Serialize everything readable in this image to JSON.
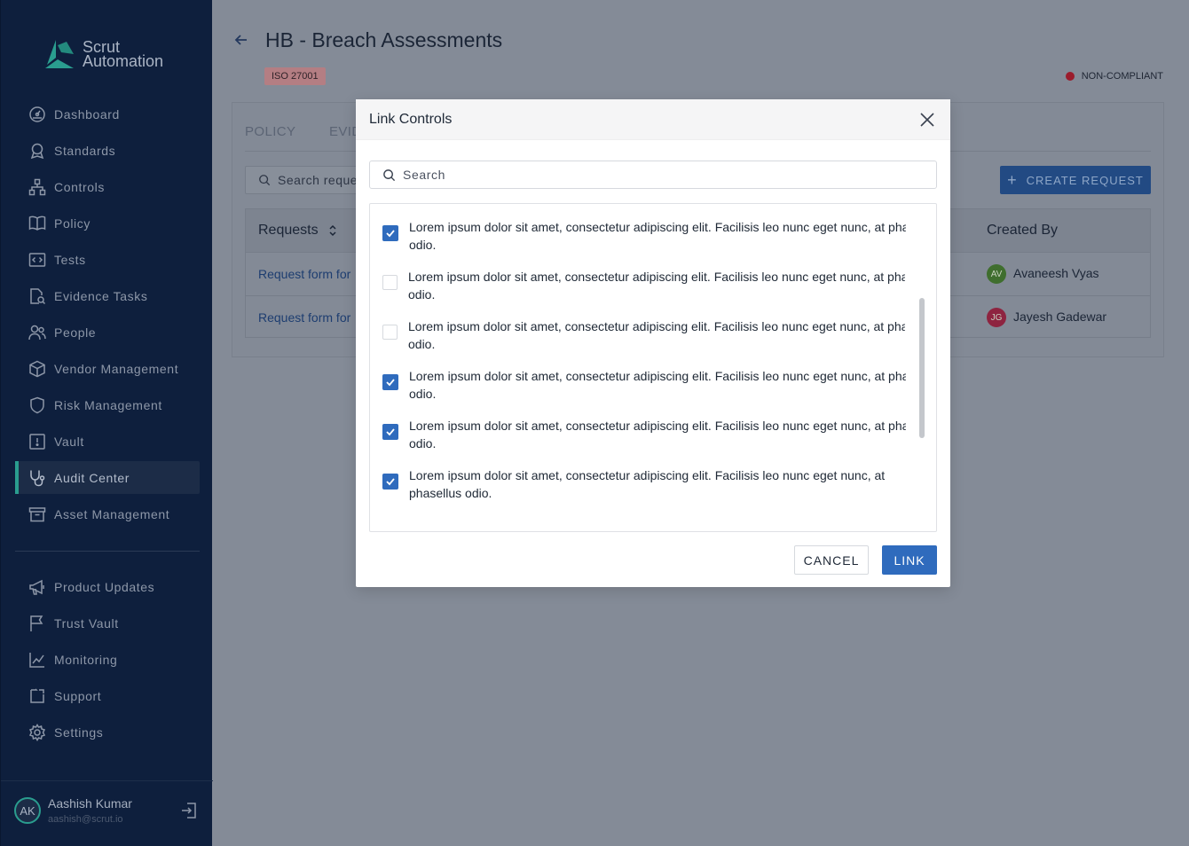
{
  "sidebar": {
    "logo_line1": "Scrut",
    "logo_line2": "Automation",
    "items": [
      {
        "label": "Dashboard",
        "icon": "dashboard-icon"
      },
      {
        "label": "Standards",
        "icon": "award-icon"
      },
      {
        "label": "Controls",
        "icon": "hierarchy-icon"
      },
      {
        "label": "Policy",
        "icon": "book-icon"
      },
      {
        "label": "Tests",
        "icon": "code-icon"
      },
      {
        "label": "Evidence Tasks",
        "icon": "file-search-icon"
      },
      {
        "label": "People",
        "icon": "people-icon"
      },
      {
        "label": "Vendor Management",
        "icon": "box-icon"
      },
      {
        "label": "Risk Management",
        "icon": "shield-icon"
      },
      {
        "label": "Vault",
        "icon": "vault-icon"
      },
      {
        "label": "Audit Center",
        "icon": "stethoscope-icon",
        "active": true
      },
      {
        "label": "Asset Management",
        "icon": "archive-icon"
      }
    ],
    "items2": [
      {
        "label": "Product Updates",
        "icon": "megaphone-icon"
      },
      {
        "label": "Trust Vault",
        "icon": "flag-icon"
      },
      {
        "label": "Monitoring",
        "icon": "chart-line-icon"
      },
      {
        "label": "Support",
        "icon": "support-icon"
      },
      {
        "label": "Settings",
        "icon": "gear-icon"
      }
    ],
    "user": {
      "initials": "AK",
      "name": "Aashish Kumar",
      "email": "aashish@scrut.io"
    }
  },
  "page": {
    "title": "HB - Breach Assessments",
    "badge": "ISO 27001",
    "status": "NON-COMPLIANT",
    "tabs": [
      "POLICY",
      "EVID"
    ],
    "search_placeholder": "Search reque",
    "create_button": "CREATE REQUEST",
    "table": {
      "col_requests": "Requests",
      "col_created_by": "Created By",
      "rows": [
        {
          "request": "Request form for",
          "initials": "AV",
          "creator": "Avaneesh Vyas",
          "avatar_color": "#3f6e2e"
        },
        {
          "request": "Request form for",
          "initials": "JG",
          "creator": "Jayesh Gadewar",
          "avatar_color": "#8e2440"
        }
      ]
    }
  },
  "modal": {
    "title": "Link Controls",
    "search_placeholder": "Search",
    "items": [
      {
        "line1": "Lorem ipsum dolor sit amet, consectetur adipiscing elit. Facilisis leo nunc eget nunc, at phasell",
        "line2": "odio.",
        "checked": true
      },
      {
        "line1": "Lorem ipsum dolor sit amet, consectetur adipiscing elit. Facilisis leo nunc eget nunc, at phasellu",
        "line2": "odio.",
        "checked": false
      },
      {
        "line1": "Lorem ipsum dolor sit amet, consectetur adipiscing elit. Facilisis leo nunc eget nunc, at phasellu",
        "line2": "odio.",
        "checked": false
      },
      {
        "line1": "Lorem ipsum dolor sit amet, consectetur adipiscing elit. Facilisis leo nunc eget nunc, at phasell",
        "line2": "odio.",
        "checked": true
      },
      {
        "line1": "Lorem ipsum dolor sit amet, consectetur adipiscing elit. Facilisis leo nunc eget nunc, at phasell",
        "line2": "odio.",
        "checked": true
      },
      {
        "line1": "Lorem ipsum dolor sit amet, consectetur adipiscing elit. Facilisis leo nunc eget nunc, at",
        "line2": "phasellus odio.",
        "checked": true
      }
    ],
    "cancel_label": "CANCEL",
    "link_label": "LINK"
  },
  "colors": {
    "sidebar_bg": "#0e1f3d",
    "accent_teal": "#2a9d8f",
    "primary_blue": "#2f6bbd",
    "overlay_bg": "#848b97",
    "status_red": "#9b1c2c"
  }
}
